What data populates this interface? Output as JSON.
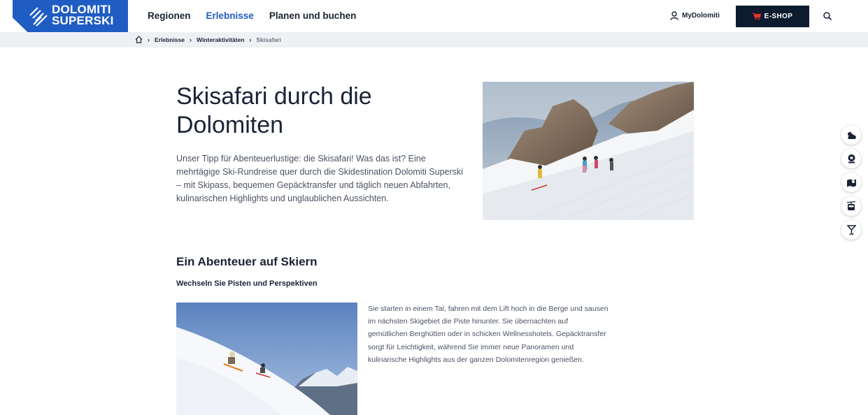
{
  "header": {
    "logo_line1": "DOLOMITI",
    "logo_line2": "SUPERSKI",
    "nav": [
      {
        "label": "Regionen",
        "active": false
      },
      {
        "label": "Erlebnisse",
        "active": true
      },
      {
        "label": "Planen und buchen",
        "active": false
      }
    ],
    "mydolomiti_label": "MyDolomiti",
    "eshop_label": "E-SHOP"
  },
  "breadcrumb": {
    "items": [
      "Erlebnisse",
      "Winteraktivitäten"
    ],
    "current": "Skisafari"
  },
  "hero": {
    "title": "Skisafari durch die Dolomiten",
    "text": "Unser Tipp für Abenteuerlustige: die Skisafari! Was das ist? Eine mehrtägige Ski-Rundreise quer durch die Skidestination Dolomiti Superski – mit Skipass, bequemen Gepäcktransfer und täglich neuen Abfahrten, kulinarischen Highlights und unglaublichen Aussichten."
  },
  "section": {
    "title": "Ein Abenteuer auf Skiern",
    "subtitle": "Wechseln Sie Pisten und Perspektiven",
    "text": "Sie starten in einem Tal, fahren mit dem Lift hoch in die Berge und sausen im nächsten Skigebiet die Piste hinunter. Sie übernachten auf gemütlichen Berghütten oder in schicken Wellnesshotels. Gepäcktransfer sorgt für Leichtigkeit, während Sie immer neue Panoramen und kulinarische Highlights aus der ganzen Dolomitenregion genießen."
  },
  "side_buttons": [
    "weather-icon",
    "webcam-icon",
    "map-icon",
    "gondola-icon",
    "apres-ski-icon"
  ],
  "colors": {
    "brand": "#1f5cc4",
    "dark": "#0d1b2e",
    "cart": "#e8312f"
  }
}
